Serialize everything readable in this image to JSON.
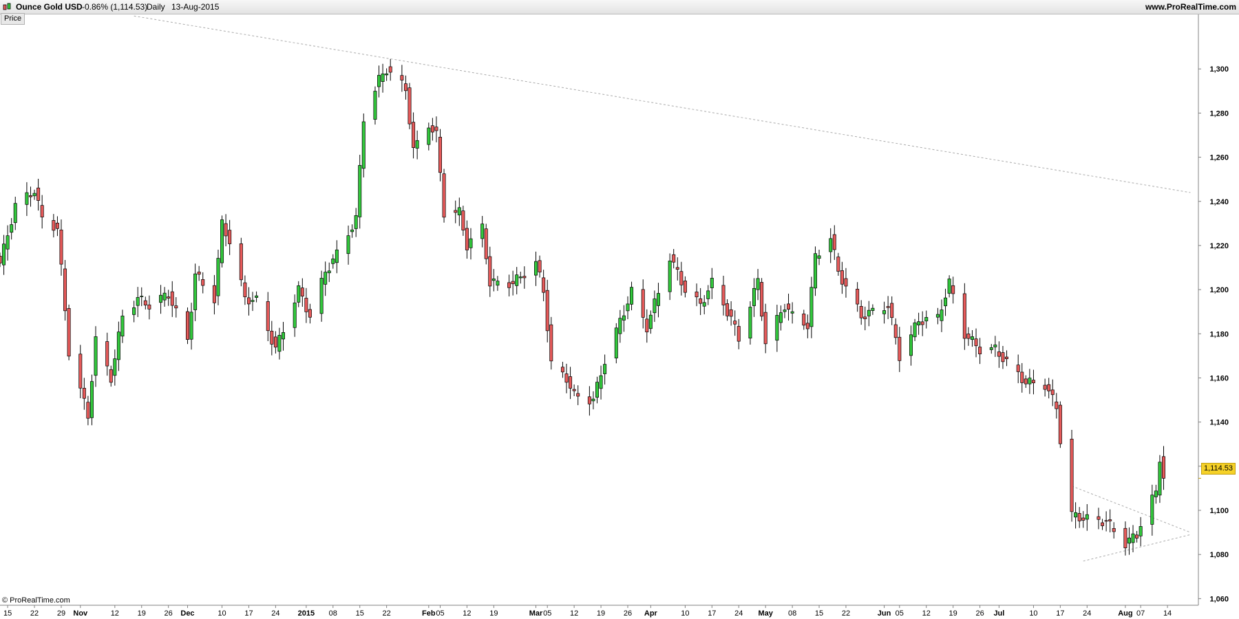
{
  "header": {
    "instrument": "Ounce Gold USD",
    "change": "-0.86% (1,114.53)",
    "period": "Daily",
    "date": "13-Aug-2015",
    "website": "www.ProRealTime.com"
  },
  "panel_tab": "Price",
  "footer": "© ProRealTime.com",
  "last_price_label": "1,114.53",
  "colors": {
    "up": "#32c83c",
    "down": "#e65a5a",
    "grid": "#d0d0d0",
    "trend": "#aaaaaa",
    "last_price_bg": "#f5d128"
  },
  "chart_data": {
    "type": "candlestick",
    "title": "Ounce Gold USD",
    "timeframe": "Daily",
    "ylim": [
      1057,
      1325
    ],
    "y_ticks": [
      1060,
      1080,
      1100,
      1120,
      1140,
      1160,
      1180,
      1200,
      1220,
      1240,
      1260,
      1280,
      1300
    ],
    "y_tick_labels": [
      "1,060",
      "1,080",
      "1,100",
      "1,120",
      "1,140",
      "1,160",
      "1,180",
      "1,200",
      "1,220",
      "1,240",
      "1,260",
      "1,280",
      "1,300"
    ],
    "x_labels": [
      {
        "t": "15",
        "d": "2014-10-15"
      },
      {
        "t": "22",
        "d": "2014-10-22"
      },
      {
        "t": "29",
        "d": "2014-10-29"
      },
      {
        "t": "Nov",
        "d": "2014-11-03",
        "bold": true
      },
      {
        "t": "12",
        "d": "2014-11-12"
      },
      {
        "t": "19",
        "d": "2014-11-19"
      },
      {
        "t": "26",
        "d": "2014-11-26"
      },
      {
        "t": "Dec",
        "d": "2014-12-01",
        "bold": true
      },
      {
        "t": "10",
        "d": "2014-12-10"
      },
      {
        "t": "17",
        "d": "2014-12-17"
      },
      {
        "t": "24",
        "d": "2014-12-24"
      },
      {
        "t": "2015",
        "d": "2015-01-01",
        "bold": true
      },
      {
        "t": "08",
        "d": "2015-01-08"
      },
      {
        "t": "15",
        "d": "2015-01-15"
      },
      {
        "t": "22",
        "d": "2015-01-22"
      },
      {
        "t": "Feb",
        "d": "2015-02-02",
        "bold": true
      },
      {
        "t": "05",
        "d": "2015-02-05"
      },
      {
        "t": "12",
        "d": "2015-02-12"
      },
      {
        "t": "19",
        "d": "2015-02-19"
      },
      {
        "t": "Mar",
        "d": "2015-03-02",
        "bold": true
      },
      {
        "t": "05",
        "d": "2015-03-05"
      },
      {
        "t": "12",
        "d": "2015-03-12"
      },
      {
        "t": "19",
        "d": "2015-03-19"
      },
      {
        "t": "26",
        "d": "2015-03-26"
      },
      {
        "t": "Apr",
        "d": "2015-04-01",
        "bold": true
      },
      {
        "t": "10",
        "d": "2015-04-10"
      },
      {
        "t": "17",
        "d": "2015-04-17"
      },
      {
        "t": "24",
        "d": "2015-04-24"
      },
      {
        "t": "May",
        "d": "2015-05-01",
        "bold": true
      },
      {
        "t": "08",
        "d": "2015-05-08"
      },
      {
        "t": "15",
        "d": "2015-05-15"
      },
      {
        "t": "22",
        "d": "2015-05-22"
      },
      {
        "t": "Jun",
        "d": "2015-06-01",
        "bold": true
      },
      {
        "t": "05",
        "d": "2015-06-05"
      },
      {
        "t": "12",
        "d": "2015-06-12"
      },
      {
        "t": "19",
        "d": "2015-06-19"
      },
      {
        "t": "26",
        "d": "2015-06-26"
      },
      {
        "t": "Jul",
        "d": "2015-07-01",
        "bold": true
      },
      {
        "t": "10",
        "d": "2015-07-10"
      },
      {
        "t": "17",
        "d": "2015-07-17"
      },
      {
        "t": "24",
        "d": "2015-07-24"
      },
      {
        "t": "Aug",
        "d": "2015-08-03",
        "bold": true
      },
      {
        "t": "07",
        "d": "2015-08-07"
      },
      {
        "t": "14",
        "d": "2015-08-14"
      }
    ],
    "anchors": [
      [
        "2014-10-13",
        1212
      ],
      [
        "2014-10-17",
        1238
      ],
      [
        "2014-10-22",
        1245
      ],
      [
        "2014-10-24",
        1232
      ],
      [
        "2014-10-28",
        1228
      ],
      [
        "2014-10-31",
        1172
      ],
      [
        "2014-11-05",
        1143
      ],
      [
        "2014-11-07",
        1177
      ],
      [
        "2014-11-11",
        1160
      ],
      [
        "2014-11-14",
        1188
      ],
      [
        "2014-11-18",
        1196
      ],
      [
        "2014-11-21",
        1193
      ],
      [
        "2014-11-26",
        1198
      ],
      [
        "2014-12-01",
        1177
      ],
      [
        "2014-12-03",
        1207
      ],
      [
        "2014-12-08",
        1196
      ],
      [
        "2014-12-10",
        1230
      ],
      [
        "2014-12-12",
        1222
      ],
      [
        "2014-12-16",
        1196
      ],
      [
        "2014-12-19",
        1195
      ],
      [
        "2014-12-24",
        1173
      ],
      [
        "2014-12-30",
        1200
      ],
      [
        "2015-01-02",
        1188
      ],
      [
        "2015-01-06",
        1208
      ],
      [
        "2015-01-09",
        1216
      ],
      [
        "2015-01-14",
        1232
      ],
      [
        "2015-01-16",
        1278
      ],
      [
        "2015-01-20",
        1295
      ],
      [
        "2015-01-22",
        1300
      ],
      [
        "2015-01-27",
        1291
      ],
      [
        "2015-01-29",
        1263
      ],
      [
        "2015-02-02",
        1275
      ],
      [
        "2015-02-04",
        1270
      ],
      [
        "2015-02-06",
        1235
      ],
      [
        "2015-02-10",
        1235
      ],
      [
        "2015-02-12",
        1220
      ],
      [
        "2015-02-16",
        1228
      ],
      [
        "2015-02-18",
        1203
      ],
      [
        "2015-02-24",
        1203
      ],
      [
        "2015-03-02",
        1212
      ],
      [
        "2015-03-04",
        1200
      ],
      [
        "2015-03-06",
        1166
      ],
      [
        "2015-03-10",
        1160
      ],
      [
        "2015-03-12",
        1152
      ],
      [
        "2015-03-17",
        1150
      ],
      [
        "2015-03-20",
        1168
      ],
      [
        "2015-03-25",
        1190
      ],
      [
        "2015-03-27",
        1199
      ],
      [
        "2015-03-31",
        1183
      ],
      [
        "2015-04-06",
        1215
      ],
      [
        "2015-04-10",
        1200
      ],
      [
        "2015-04-14",
        1193
      ],
      [
        "2015-04-17",
        1203
      ],
      [
        "2015-04-22",
        1187
      ],
      [
        "2015-04-24",
        1178
      ],
      [
        "2015-04-29",
        1204
      ],
      [
        "2015-05-01",
        1176
      ],
      [
        "2015-05-06",
        1193
      ],
      [
        "2015-05-08",
        1188
      ],
      [
        "2015-05-12",
        1184
      ],
      [
        "2015-05-14",
        1215
      ],
      [
        "2015-05-18",
        1224
      ],
      [
        "2015-05-20",
        1208
      ],
      [
        "2015-05-26",
        1188
      ],
      [
        "2015-05-29",
        1190
      ],
      [
        "2015-06-02",
        1193
      ],
      [
        "2015-06-05",
        1170
      ],
      [
        "2015-06-10",
        1186
      ],
      [
        "2015-06-15",
        1187
      ],
      [
        "2015-06-18",
        1203
      ],
      [
        "2015-06-22",
        1180
      ],
      [
        "2015-06-26",
        1173
      ],
      [
        "2015-06-30",
        1173
      ],
      [
        "2015-07-03",
        1167
      ],
      [
        "2015-07-08",
        1158
      ],
      [
        "2015-07-13",
        1157
      ],
      [
        "2015-07-16",
        1147
      ],
      [
        "2015-07-17",
        1132
      ],
      [
        "2015-07-20",
        1098
      ],
      [
        "2015-07-24",
        1096
      ],
      [
        "2015-07-29",
        1095
      ],
      [
        "2015-08-03",
        1085
      ],
      [
        "2015-08-06",
        1089
      ],
      [
        "2015-08-07",
        1094
      ],
      [
        "2015-08-10",
        1105
      ],
      [
        "2015-08-11",
        1108
      ],
      [
        "2015-08-12",
        1124
      ],
      [
        "2015-08-13",
        1114.53
      ]
    ],
    "trendlines": [
      {
        "from": [
          "2014-11-17",
          1324
        ],
        "to": [
          "2015-08-20",
          1244
        ]
      },
      {
        "from": [
          "2015-07-20",
          1111
        ],
        "to": [
          "2015-08-20",
          1090
        ]
      },
      {
        "from": [
          "2015-07-23",
          1077
        ],
        "to": [
          "2015-08-20",
          1089
        ]
      }
    ],
    "last_price": 1114.53
  }
}
